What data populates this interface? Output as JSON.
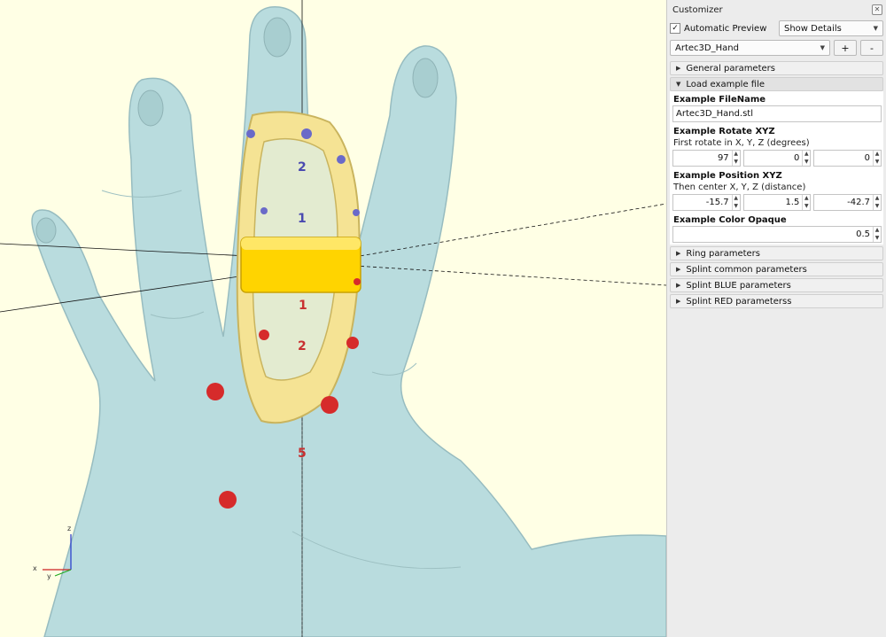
{
  "customizer": {
    "title": "Customizer",
    "close_icon": "✕",
    "automatic_preview": {
      "label": "Automatic Preview",
      "checked": true
    },
    "details_select": "Show Details",
    "preset_select": "Artec3D_Hand",
    "add_label": "+",
    "remove_label": "-",
    "sections": {
      "general": "General parameters",
      "load_example": "Load example file",
      "ring": "Ring parameters",
      "splint_common": "Splint common parameters",
      "splint_blue": "Splint BLUE parameters",
      "splint_red": "Splint RED parameterss"
    },
    "params": {
      "filename": {
        "label": "Example FileName",
        "value": "Artec3D_Hand.stl"
      },
      "rotate": {
        "label": "Example Rotate XYZ",
        "desc": "First rotate in X, Y, Z  (degrees)",
        "values": [
          "97",
          "0",
          "0"
        ]
      },
      "position": {
        "label": "Example Position XYZ",
        "desc": "Then center X, Y, Z (distance)",
        "values": [
          "-15.7",
          "1.5",
          "-42.7"
        ]
      },
      "color": {
        "label": "Example Color Opaque",
        "value": "0.5"
      }
    }
  },
  "viewport": {
    "ruler_blue": [
      "2",
      "1"
    ],
    "ruler_red": [
      "1",
      "2",
      "5"
    ],
    "axes": {
      "z": "z",
      "x": "x",
      "y": "y"
    },
    "colors": {
      "background": "#ffffe5",
      "hand": "#b9dcde",
      "splint": "#f5e394",
      "ring": "#ffd400",
      "blue_marker": "#6a6ac8",
      "red_marker": "#d62b2b"
    }
  }
}
